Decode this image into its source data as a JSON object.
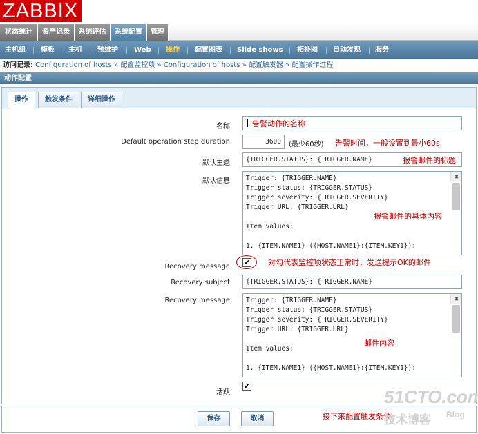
{
  "app": {
    "logo": "ZABBIX"
  },
  "main_menu": [
    "状态统计",
    "资产记录",
    "系统评估",
    "系统配置",
    "管理"
  ],
  "sub_menu": [
    "主机组",
    "模板",
    "主机",
    "预维护",
    "Web",
    "操作",
    "配置图表",
    "Slide shows",
    "拓扑图",
    "自动发现",
    "服务"
  ],
  "breadcrumb": {
    "prefix": "访问记录:",
    "items": [
      "Configuration of hosts",
      "配置监控项",
      "Configuration of hosts",
      "配置触发器",
      "配置操作过程"
    ],
    "sep": "»"
  },
  "section_title": "动作配置",
  "tabs": [
    "操作",
    "触发条件",
    "详细操作"
  ],
  "form": {
    "name_label": "名称",
    "name_value": "",
    "step_label": "Default operation step duration",
    "step_value": "3600",
    "step_hint": "(最少60秒)",
    "subject_label": "默认主题",
    "subject_value": "{TRIGGER.STATUS}: {TRIGGER.NAME}",
    "message_label": "默认信息",
    "message_lines": [
      "Trigger: {TRIGGER.NAME}",
      "Trigger status: {TRIGGER.STATUS}",
      "Trigger severity: {TRIGGER.SEVERITY}",
      "Trigger URL: {TRIGGER.URL}",
      "",
      "Item values:",
      "",
      "1. {ITEM.NAME1} ({HOST.NAME1}:{ITEM.KEY1}):"
    ],
    "recovery_msg_label": "Recovery message",
    "recovery_subject_label": "Recovery subject",
    "recovery_subject_value": "{TRIGGER.STATUS}: {TRIGGER.NAME}",
    "recovery_message_label": "Recovery message",
    "recovery_lines": [
      "Trigger: {TRIGGER.NAME}",
      "Trigger status: {TRIGGER.STATUS}",
      "Trigger severity: {TRIGGER.SEVERITY}",
      "Trigger URL: {TRIGGER.URL}",
      "",
      "Item values:",
      "",
      "1. {ITEM.NAME1} ({HOST.NAME1}:{ITEM.KEY1}):"
    ],
    "active_label": "活跃",
    "checkbox_glyph": "✔"
  },
  "annotations": {
    "name": "告警动作的名称",
    "step": "告警时间，一般设置到最小60s",
    "subject": "报警邮件的标题",
    "message": "报警邮件的具体内容",
    "recovery": "对勾代表监控项状态正常时，发送提示OK的邮件",
    "recovery_body": "邮件内容",
    "next": "接下来配置触发条件"
  },
  "buttons": {
    "save": "保存",
    "cancel": "取消"
  },
  "scroll_glyphs": {
    "up": "▲",
    "down": "▼"
  },
  "watermark": {
    "brand": "51CTO.com",
    "sub": "技术博客",
    "blog": "Blog"
  },
  "colors": {
    "logo_red": "#d40000",
    "menu_blue": "#4d7ea3",
    "annotation_red": "#c00000"
  }
}
